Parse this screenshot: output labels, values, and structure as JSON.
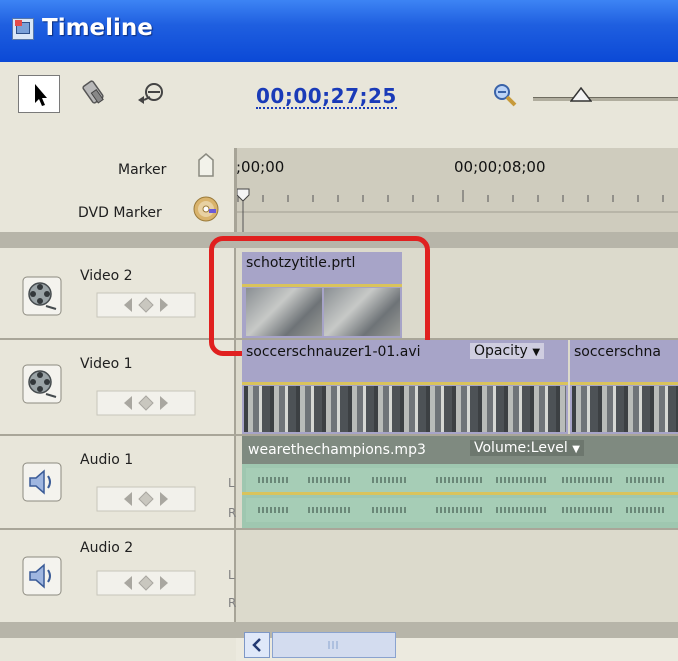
{
  "window": {
    "title": "Timeline"
  },
  "toolbar": {
    "timecode": "00;00;27;25"
  },
  "ruler": {
    "marker_label": "Marker",
    "dvd_marker_label": "DVD Marker",
    "ticks": [
      ";00;00",
      "00;00;08;00"
    ]
  },
  "tracks": [
    {
      "name": "Video 2",
      "type": "video"
    },
    {
      "name": "Video 1",
      "type": "video"
    },
    {
      "name": "Audio 1",
      "type": "audio",
      "channels": [
        "L",
        "R"
      ]
    },
    {
      "name": "Audio 2",
      "type": "audio",
      "channels": [
        "L",
        "R"
      ]
    }
  ],
  "clips": {
    "title_clip": {
      "label": "schotzytitle.prtl"
    },
    "video1_clip_a": {
      "label": "soccerschnauzer1-01.avi",
      "effect": "Opacity"
    },
    "video1_clip_b": {
      "label": "soccerschna"
    },
    "audio1_clip": {
      "label": "wearethechampions.mp3",
      "effect": "Volume:Level"
    }
  },
  "colors": {
    "title_bar": "#0b49d6",
    "timecode": "#1a3bb8",
    "highlight": "#e0201f",
    "audio_clip": "#9fc7b0",
    "video_clip": "#a7a4c8"
  }
}
